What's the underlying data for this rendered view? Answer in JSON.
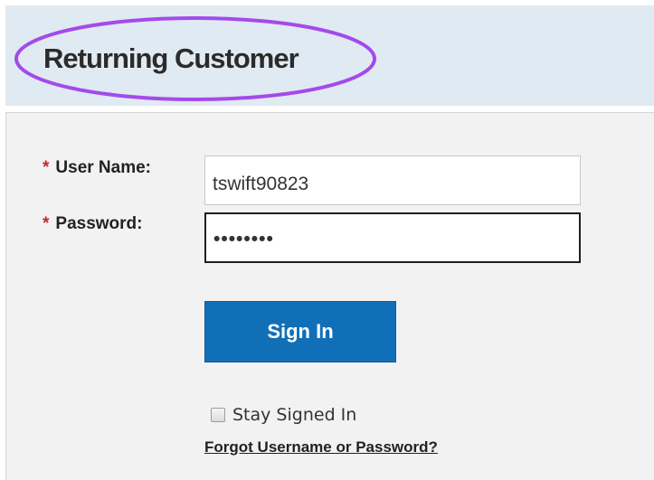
{
  "section": {
    "title": "Returning Customer",
    "annotation_color": "#a34bea"
  },
  "form": {
    "required_marker": "*",
    "username": {
      "label": "User Name:",
      "value": "tswift90823"
    },
    "password": {
      "label": "Password:",
      "masked_value": "••••••••"
    },
    "sign_in_label": "Sign In",
    "stay_signed_in": {
      "label": "Stay Signed In",
      "checked": false
    },
    "forgot_link": "Forgot Username or Password?"
  },
  "colors": {
    "header_background": "#e0eaf2",
    "panel_background": "#f2f2f2",
    "button_blue": "#116fb8",
    "required_red": "#c0272d"
  }
}
